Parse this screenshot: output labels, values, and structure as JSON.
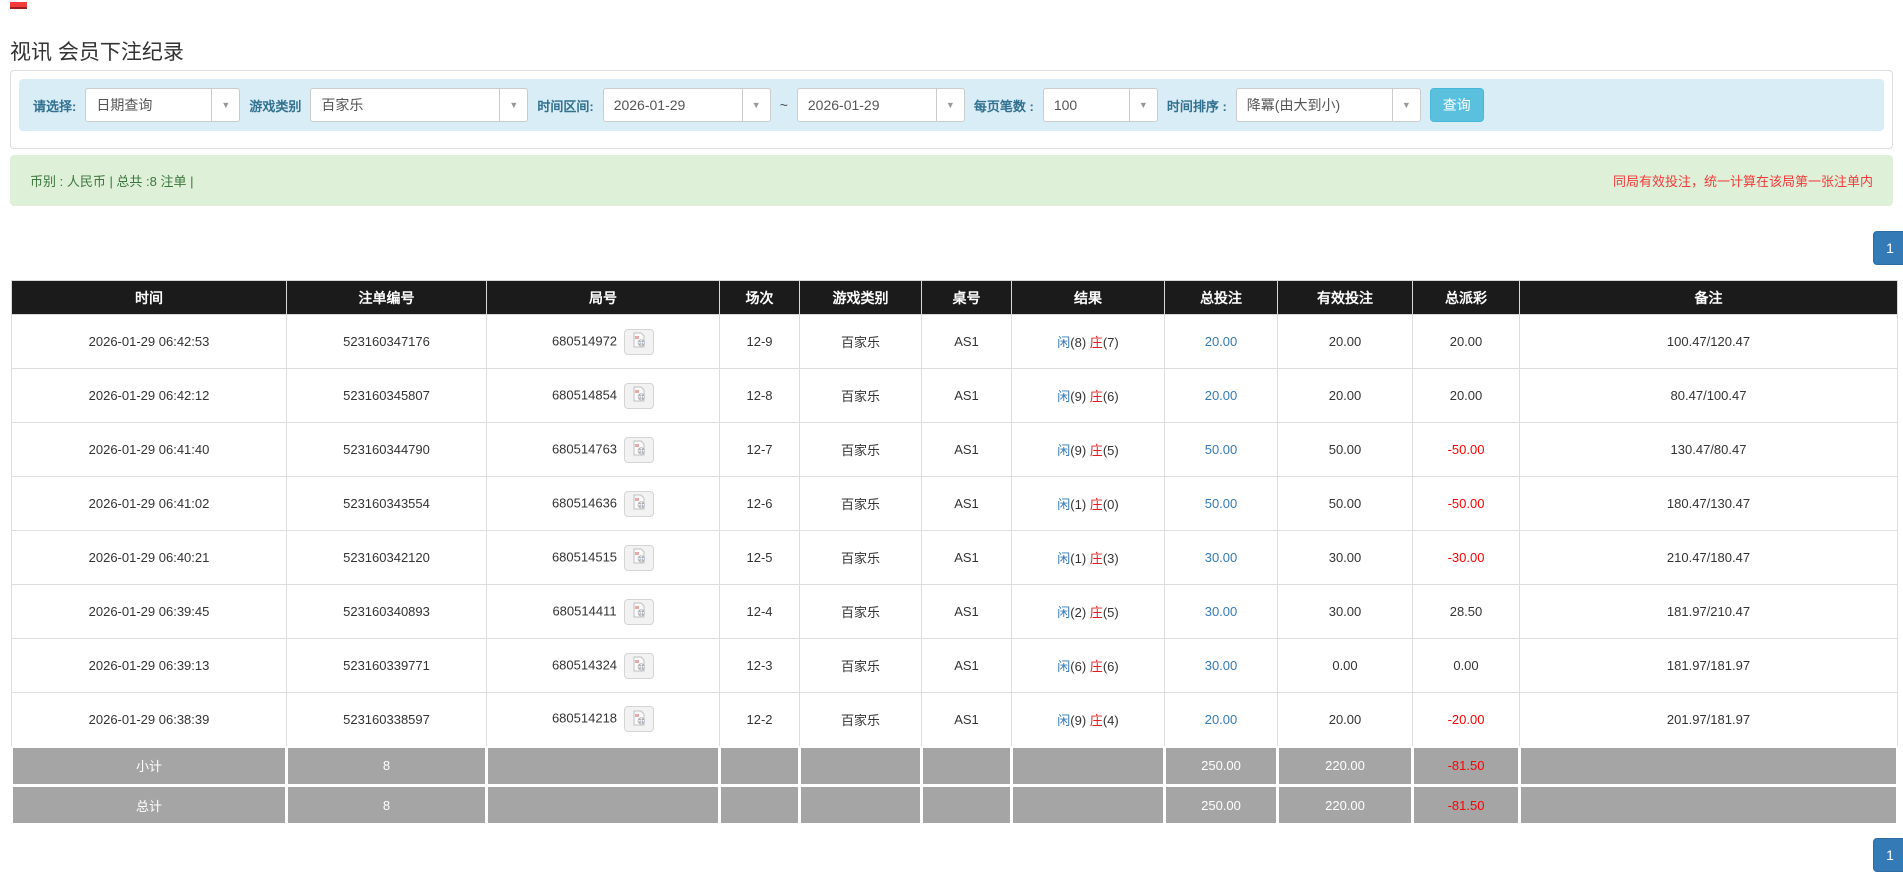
{
  "page": {
    "title": "视讯 会员下注纪录"
  },
  "filters": {
    "query_type": {
      "label": "请选择:",
      "value": "日期查询"
    },
    "game_category": {
      "label": "游戏类别",
      "value": "百家乐"
    },
    "date_range": {
      "label": "时间区间:",
      "from": "2026-01-29",
      "separator": "~",
      "to": "2026-01-29"
    },
    "page_size": {
      "label": "每页笔数 :",
      "value": "100"
    },
    "time_sort": {
      "label": "时间排序 :",
      "value": "降冪(由大到小)"
    },
    "search_button": "查询"
  },
  "summary_bar": {
    "left_text": "币别 : 人民币 | 总共 :8 注单 |",
    "right_notice": "同局有效投注，统一计算在该局第一张注单内"
  },
  "pagination": {
    "page": "1"
  },
  "table": {
    "headers": [
      "时间",
      "注单编号",
      "局号",
      "场次",
      "游戏类别",
      "桌号",
      "结果",
      "总投注",
      "有效投注",
      "总派彩",
      "备注"
    ],
    "rows": [
      {
        "time": "2026-01-29 06:42:53",
        "bet_no": "523160347176",
        "round_no": "680514972",
        "session": "12-9",
        "game": "百家乐",
        "table_no": "AS1",
        "result": {
          "player_label": "闲",
          "player_score": "(8)",
          "banker_label": "庄",
          "banker_score": "(7)"
        },
        "total_bet": "20.00",
        "valid_bet": "20.00",
        "payout": "20.00",
        "remark": "100.47/120.47"
      },
      {
        "time": "2026-01-29 06:42:12",
        "bet_no": "523160345807",
        "round_no": "680514854",
        "session": "12-8",
        "game": "百家乐",
        "table_no": "AS1",
        "result": {
          "player_label": "闲",
          "player_score": "(9)",
          "banker_label": "庄",
          "banker_score": "(6)"
        },
        "total_bet": "20.00",
        "valid_bet": "20.00",
        "payout": "20.00",
        "remark": "80.47/100.47"
      },
      {
        "time": "2026-01-29 06:41:40",
        "bet_no": "523160344790",
        "round_no": "680514763",
        "session": "12-7",
        "game": "百家乐",
        "table_no": "AS1",
        "result": {
          "player_label": "闲",
          "player_score": "(9)",
          "banker_label": "庄",
          "banker_score": "(5)"
        },
        "total_bet": "50.00",
        "valid_bet": "50.00",
        "payout": "-50.00",
        "remark": "130.47/80.47"
      },
      {
        "time": "2026-01-29 06:41:02",
        "bet_no": "523160343554",
        "round_no": "680514636",
        "session": "12-6",
        "game": "百家乐",
        "table_no": "AS1",
        "result": {
          "player_label": "闲",
          "player_score": "(1)",
          "banker_label": "庄",
          "banker_score": "(0)"
        },
        "total_bet": "50.00",
        "valid_bet": "50.00",
        "payout": "-50.00",
        "remark": "180.47/130.47"
      },
      {
        "time": "2026-01-29 06:40:21",
        "bet_no": "523160342120",
        "round_no": "680514515",
        "session": "12-5",
        "game": "百家乐",
        "table_no": "AS1",
        "result": {
          "player_label": "闲",
          "player_score": "(1)",
          "banker_label": "庄",
          "banker_score": "(3)"
        },
        "total_bet": "30.00",
        "valid_bet": "30.00",
        "payout": "-30.00",
        "remark": "210.47/180.47"
      },
      {
        "time": "2026-01-29 06:39:45",
        "bet_no": "523160340893",
        "round_no": "680514411",
        "session": "12-4",
        "game": "百家乐",
        "table_no": "AS1",
        "result": {
          "player_label": "闲",
          "player_score": "(2)",
          "banker_label": "庄",
          "banker_score": "(5)"
        },
        "total_bet": "30.00",
        "valid_bet": "30.00",
        "payout": "28.50",
        "remark": "181.97/210.47"
      },
      {
        "time": "2026-01-29 06:39:13",
        "bet_no": "523160339771",
        "round_no": "680514324",
        "session": "12-3",
        "game": "百家乐",
        "table_no": "AS1",
        "result": {
          "player_label": "闲",
          "player_score": "(6)",
          "banker_label": "庄",
          "banker_score": "(6)"
        },
        "total_bet": "30.00",
        "valid_bet": "0.00",
        "payout": "0.00",
        "remark": "181.97/181.97"
      },
      {
        "time": "2026-01-29 06:38:39",
        "bet_no": "523160338597",
        "round_no": "680514218",
        "session": "12-2",
        "game": "百家乐",
        "table_no": "AS1",
        "result": {
          "player_label": "闲",
          "player_score": "(9)",
          "banker_label": "庄",
          "banker_score": "(4)"
        },
        "total_bet": "20.00",
        "valid_bet": "20.00",
        "payout": "-20.00",
        "remark": "201.97/181.97"
      }
    ],
    "footer": [
      {
        "label": "小计",
        "count": "8",
        "total_bet": "250.00",
        "valid_bet": "220.00",
        "payout": "-81.50"
      },
      {
        "label": "总计",
        "count": "8",
        "total_bet": "250.00",
        "valid_bet": "220.00",
        "payout": "-81.50"
      }
    ]
  },
  "colors": {
    "accent": "#337ab7",
    "button": "#5bc0de",
    "banker_red": "#e02020",
    "negative_red": "#ff0000",
    "notice_red": "#f43b3b",
    "filter_bg": "#d9edf7",
    "filter_label": "#31708f",
    "success_bg": "#dff0d8",
    "success_text": "#3c763d",
    "header_bg": "#1b1b1b",
    "footer_bg": "#a5a5a5"
  }
}
